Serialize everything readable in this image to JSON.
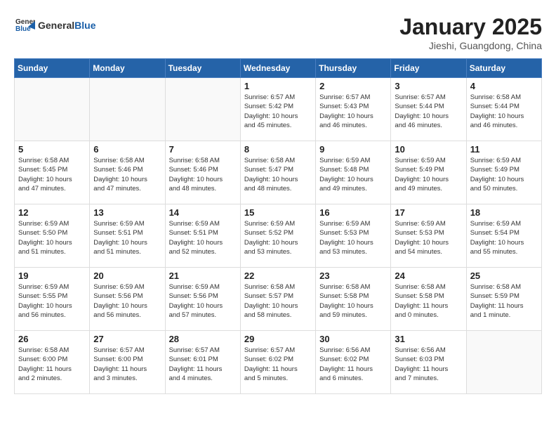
{
  "header": {
    "logo_general": "General",
    "logo_blue": "Blue",
    "month_title": "January 2025",
    "location": "Jieshi, Guangdong, China"
  },
  "weekdays": [
    "Sunday",
    "Monday",
    "Tuesday",
    "Wednesday",
    "Thursday",
    "Friday",
    "Saturday"
  ],
  "weeks": [
    [
      {
        "day": "",
        "info": ""
      },
      {
        "day": "",
        "info": ""
      },
      {
        "day": "",
        "info": ""
      },
      {
        "day": "1",
        "info": "Sunrise: 6:57 AM\nSunset: 5:42 PM\nDaylight: 10 hours\nand 45 minutes."
      },
      {
        "day": "2",
        "info": "Sunrise: 6:57 AM\nSunset: 5:43 PM\nDaylight: 10 hours\nand 46 minutes."
      },
      {
        "day": "3",
        "info": "Sunrise: 6:57 AM\nSunset: 5:44 PM\nDaylight: 10 hours\nand 46 minutes."
      },
      {
        "day": "4",
        "info": "Sunrise: 6:58 AM\nSunset: 5:44 PM\nDaylight: 10 hours\nand 46 minutes."
      }
    ],
    [
      {
        "day": "5",
        "info": "Sunrise: 6:58 AM\nSunset: 5:45 PM\nDaylight: 10 hours\nand 47 minutes."
      },
      {
        "day": "6",
        "info": "Sunrise: 6:58 AM\nSunset: 5:46 PM\nDaylight: 10 hours\nand 47 minutes."
      },
      {
        "day": "7",
        "info": "Sunrise: 6:58 AM\nSunset: 5:46 PM\nDaylight: 10 hours\nand 48 minutes."
      },
      {
        "day": "8",
        "info": "Sunrise: 6:58 AM\nSunset: 5:47 PM\nDaylight: 10 hours\nand 48 minutes."
      },
      {
        "day": "9",
        "info": "Sunrise: 6:59 AM\nSunset: 5:48 PM\nDaylight: 10 hours\nand 49 minutes."
      },
      {
        "day": "10",
        "info": "Sunrise: 6:59 AM\nSunset: 5:49 PM\nDaylight: 10 hours\nand 49 minutes."
      },
      {
        "day": "11",
        "info": "Sunrise: 6:59 AM\nSunset: 5:49 PM\nDaylight: 10 hours\nand 50 minutes."
      }
    ],
    [
      {
        "day": "12",
        "info": "Sunrise: 6:59 AM\nSunset: 5:50 PM\nDaylight: 10 hours\nand 51 minutes."
      },
      {
        "day": "13",
        "info": "Sunrise: 6:59 AM\nSunset: 5:51 PM\nDaylight: 10 hours\nand 51 minutes."
      },
      {
        "day": "14",
        "info": "Sunrise: 6:59 AM\nSunset: 5:51 PM\nDaylight: 10 hours\nand 52 minutes."
      },
      {
        "day": "15",
        "info": "Sunrise: 6:59 AM\nSunset: 5:52 PM\nDaylight: 10 hours\nand 53 minutes."
      },
      {
        "day": "16",
        "info": "Sunrise: 6:59 AM\nSunset: 5:53 PM\nDaylight: 10 hours\nand 53 minutes."
      },
      {
        "day": "17",
        "info": "Sunrise: 6:59 AM\nSunset: 5:53 PM\nDaylight: 10 hours\nand 54 minutes."
      },
      {
        "day": "18",
        "info": "Sunrise: 6:59 AM\nSunset: 5:54 PM\nDaylight: 10 hours\nand 55 minutes."
      }
    ],
    [
      {
        "day": "19",
        "info": "Sunrise: 6:59 AM\nSunset: 5:55 PM\nDaylight: 10 hours\nand 56 minutes."
      },
      {
        "day": "20",
        "info": "Sunrise: 6:59 AM\nSunset: 5:56 PM\nDaylight: 10 hours\nand 56 minutes."
      },
      {
        "day": "21",
        "info": "Sunrise: 6:59 AM\nSunset: 5:56 PM\nDaylight: 10 hours\nand 57 minutes."
      },
      {
        "day": "22",
        "info": "Sunrise: 6:58 AM\nSunset: 5:57 PM\nDaylight: 10 hours\nand 58 minutes."
      },
      {
        "day": "23",
        "info": "Sunrise: 6:58 AM\nSunset: 5:58 PM\nDaylight: 10 hours\nand 59 minutes."
      },
      {
        "day": "24",
        "info": "Sunrise: 6:58 AM\nSunset: 5:58 PM\nDaylight: 11 hours\nand 0 minutes."
      },
      {
        "day": "25",
        "info": "Sunrise: 6:58 AM\nSunset: 5:59 PM\nDaylight: 11 hours\nand 1 minute."
      }
    ],
    [
      {
        "day": "26",
        "info": "Sunrise: 6:58 AM\nSunset: 6:00 PM\nDaylight: 11 hours\nand 2 minutes."
      },
      {
        "day": "27",
        "info": "Sunrise: 6:57 AM\nSunset: 6:00 PM\nDaylight: 11 hours\nand 3 minutes."
      },
      {
        "day": "28",
        "info": "Sunrise: 6:57 AM\nSunset: 6:01 PM\nDaylight: 11 hours\nand 4 minutes."
      },
      {
        "day": "29",
        "info": "Sunrise: 6:57 AM\nSunset: 6:02 PM\nDaylight: 11 hours\nand 5 minutes."
      },
      {
        "day": "30",
        "info": "Sunrise: 6:56 AM\nSunset: 6:02 PM\nDaylight: 11 hours\nand 6 minutes."
      },
      {
        "day": "31",
        "info": "Sunrise: 6:56 AM\nSunset: 6:03 PM\nDaylight: 11 hours\nand 7 minutes."
      },
      {
        "day": "",
        "info": ""
      }
    ]
  ]
}
